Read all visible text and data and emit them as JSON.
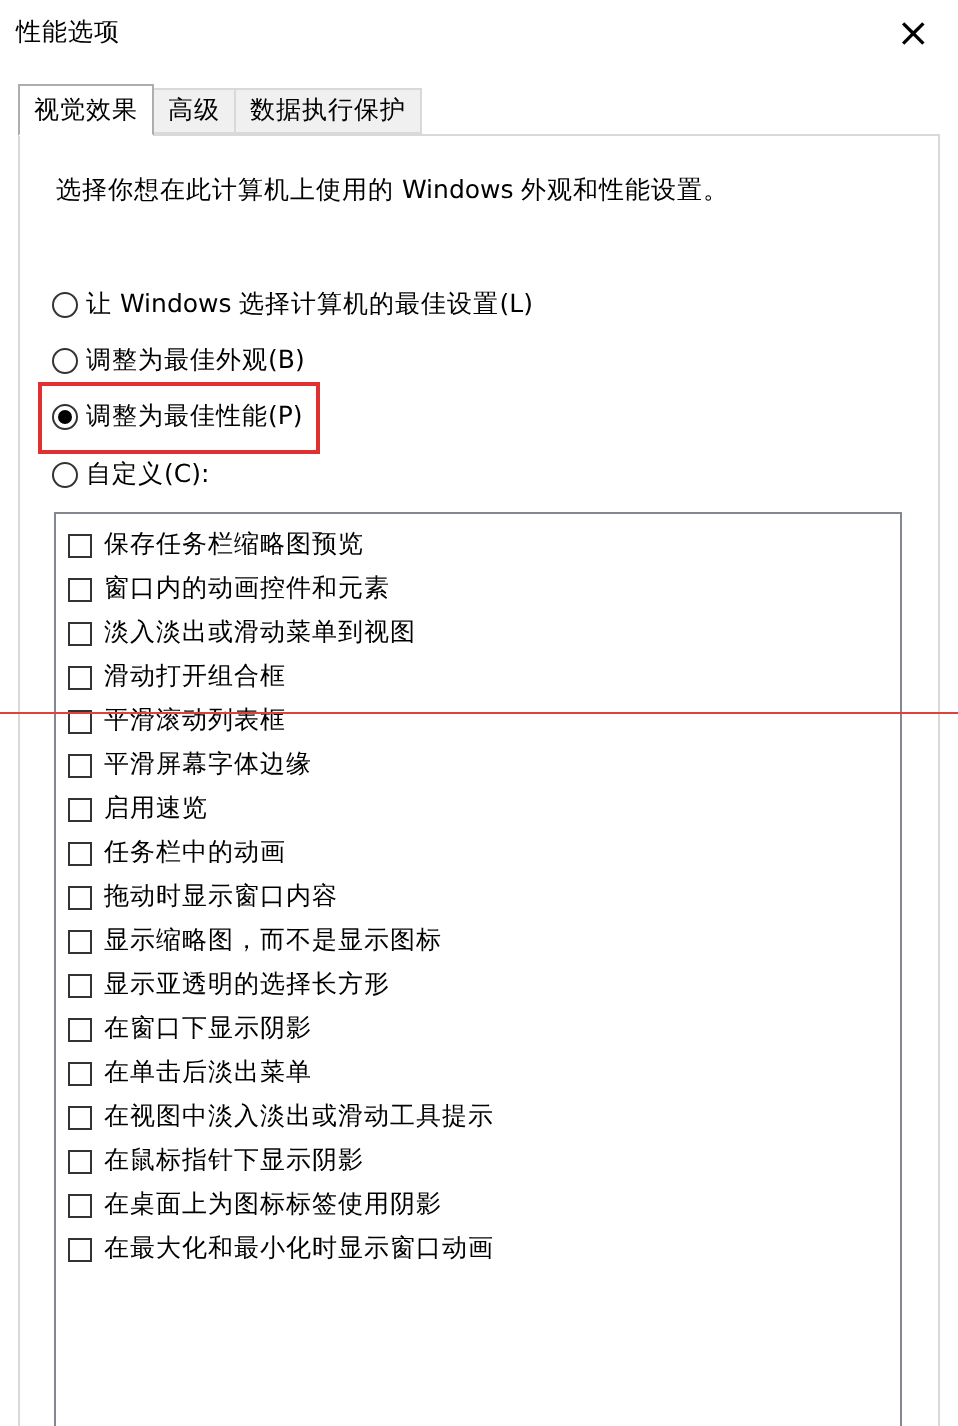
{
  "window": {
    "title": "性能选项",
    "close": "×"
  },
  "tabs": [
    {
      "label": "视觉效果",
      "selected": true
    },
    {
      "label": "高级",
      "selected": false
    },
    {
      "label": "数据执行保护",
      "selected": false
    }
  ],
  "description": "选择你想在此计算机上使用的 Windows 外观和性能设置。",
  "options": [
    {
      "label": "让 Windows 选择计算机的最佳设置(L)",
      "selected": false,
      "highlighted": false
    },
    {
      "label": "调整为最佳外观(B)",
      "selected": false,
      "highlighted": false
    },
    {
      "label": "调整为最佳性能(P)",
      "selected": true,
      "highlighted": true
    },
    {
      "label": "自定义(C):",
      "selected": false,
      "highlighted": false
    }
  ],
  "effects": [
    {
      "label": "保存任务栏缩略图预览",
      "checked": false
    },
    {
      "label": "窗口内的动画控件和元素",
      "checked": false
    },
    {
      "label": "淡入淡出或滑动菜单到视图",
      "checked": false
    },
    {
      "label": "滑动打开组合框",
      "checked": false
    },
    {
      "label": "平滑滚动列表框",
      "checked": false
    },
    {
      "label": "平滑屏幕字体边缘",
      "checked": false
    },
    {
      "label": "启用速览",
      "checked": false
    },
    {
      "label": "任务栏中的动画",
      "checked": false
    },
    {
      "label": "拖动时显示窗口内容",
      "checked": false
    },
    {
      "label": "显示缩略图，而不是显示图标",
      "checked": false
    },
    {
      "label": "显示亚透明的选择长方形",
      "checked": false
    },
    {
      "label": "在窗口下显示阴影",
      "checked": false
    },
    {
      "label": "在单击后淡出菜单",
      "checked": false
    },
    {
      "label": "在视图中淡入淡出或滑动工具提示",
      "checked": false
    },
    {
      "label": "在鼠标指针下显示阴影",
      "checked": false
    },
    {
      "label": "在桌面上为图标标签使用阴影",
      "checked": false
    },
    {
      "label": "在最大化和最小化时显示窗口动画",
      "checked": false
    }
  ]
}
